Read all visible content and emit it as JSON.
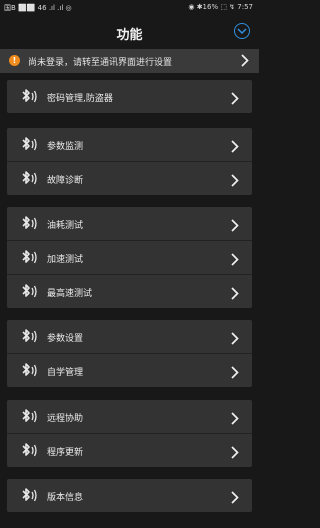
{
  "status": {
    "left_top": "国B ⬜⬜ 46 .ıl .ıl ◎",
    "right": "◉ ✱16% ⬚ ↯ 7:57"
  },
  "header": {
    "title": "功能"
  },
  "notice": {
    "text": "尚未登录，请转至通讯界面进行设置"
  },
  "groups": [
    {
      "items": [
        {
          "label": "密码管理,防盗器"
        }
      ]
    },
    {
      "items": [
        {
          "label": "参数监测"
        },
        {
          "label": "故障诊断"
        }
      ]
    },
    {
      "items": [
        {
          "label": "油耗测试"
        },
        {
          "label": "加速测试"
        },
        {
          "label": "最高速测试"
        }
      ]
    },
    {
      "items": [
        {
          "label": "参数设置"
        },
        {
          "label": "自学管理"
        }
      ]
    },
    {
      "items": [
        {
          "label": "远程协助"
        },
        {
          "label": "程序更新"
        }
      ]
    },
    {
      "items": [
        {
          "label": "版本信息"
        }
      ]
    }
  ]
}
